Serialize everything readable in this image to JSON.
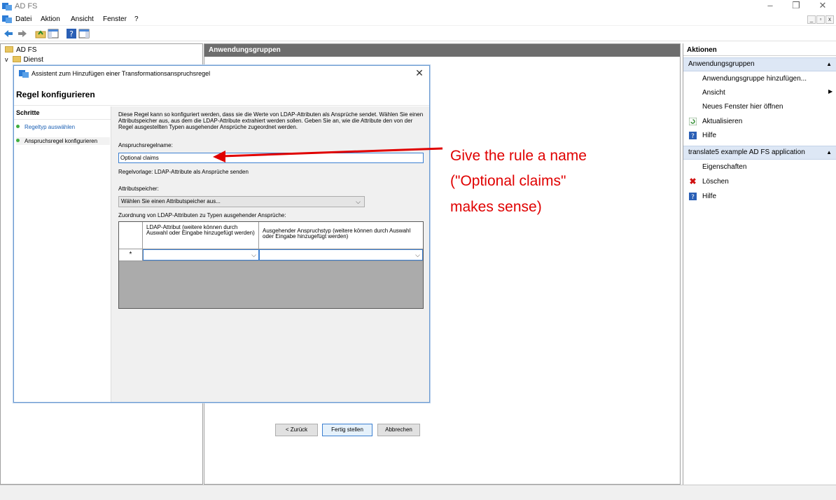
{
  "window": {
    "title": "AD FS"
  },
  "menu": [
    "Datei",
    "Aktion",
    "Ansicht",
    "Fenster",
    "?"
  ],
  "tree": {
    "root": "AD FS",
    "child": "Dienst"
  },
  "middle": {
    "header": "Anwendungsgruppen"
  },
  "actions": {
    "title": "Aktionen",
    "section1": {
      "title": "Anwendungsgruppen",
      "items": [
        "Anwendungsgruppe hinzufügen...",
        "Ansicht",
        "Neues Fenster hier öffnen",
        "Aktualisieren",
        "Hilfe"
      ]
    },
    "section2": {
      "title": "translate5 example AD FS application",
      "items": [
        "Eigenschaften",
        "Löschen",
        "Hilfe"
      ]
    }
  },
  "dialog": {
    "title": "Assistent zum Hinzufügen einer Transformationsanspruchsregel",
    "heading": "Regel konfigurieren",
    "steps_title": "Schritte",
    "steps": [
      "Regeltyp auswählen",
      "Anspruchsregel konfigurieren"
    ],
    "description": "Diese Regel kann so konfiguriert werden, dass sie die Werte von LDAP-Attributen als Ansprüche sendet. Wählen Sie einen Attributspeicher aus, aus dem die LDAP-Attribute extrahiert werden sollen. Geben Sie an, wie die Attribute den von der Regel ausgestellten Typen ausgehender Ansprüche zugeordnet werden.",
    "name_label": "Anspruchsregelname:",
    "name_value": "Optional claims",
    "template_text": "Regelvorlage: LDAP-Attribute als Ansprüche senden",
    "store_label": "Attributspeicher:",
    "store_value": "Wählen Sie einen Attributspeicher aus...",
    "mapping_label": "Zuordnung von LDAP-Attributen zu Typen ausgehender Ansprüche:",
    "col1": "LDAP-Attribut (weitere können durch Auswahl oder Eingabe hinzugefügt werden)",
    "col2": "Ausgehender Anspruchstyp (weitere können durch Auswahl oder Eingabe hinzugefügt werden)",
    "row_marker": "*",
    "buttons": {
      "back": "< Zurück",
      "finish": "Fertig stellen",
      "cancel": "Abbrechen"
    }
  },
  "annotation": {
    "line1": "Give the rule a name",
    "line2": "(\"Optional claims\"",
    "line3": "makes sense)",
    "color": "#e00000"
  }
}
